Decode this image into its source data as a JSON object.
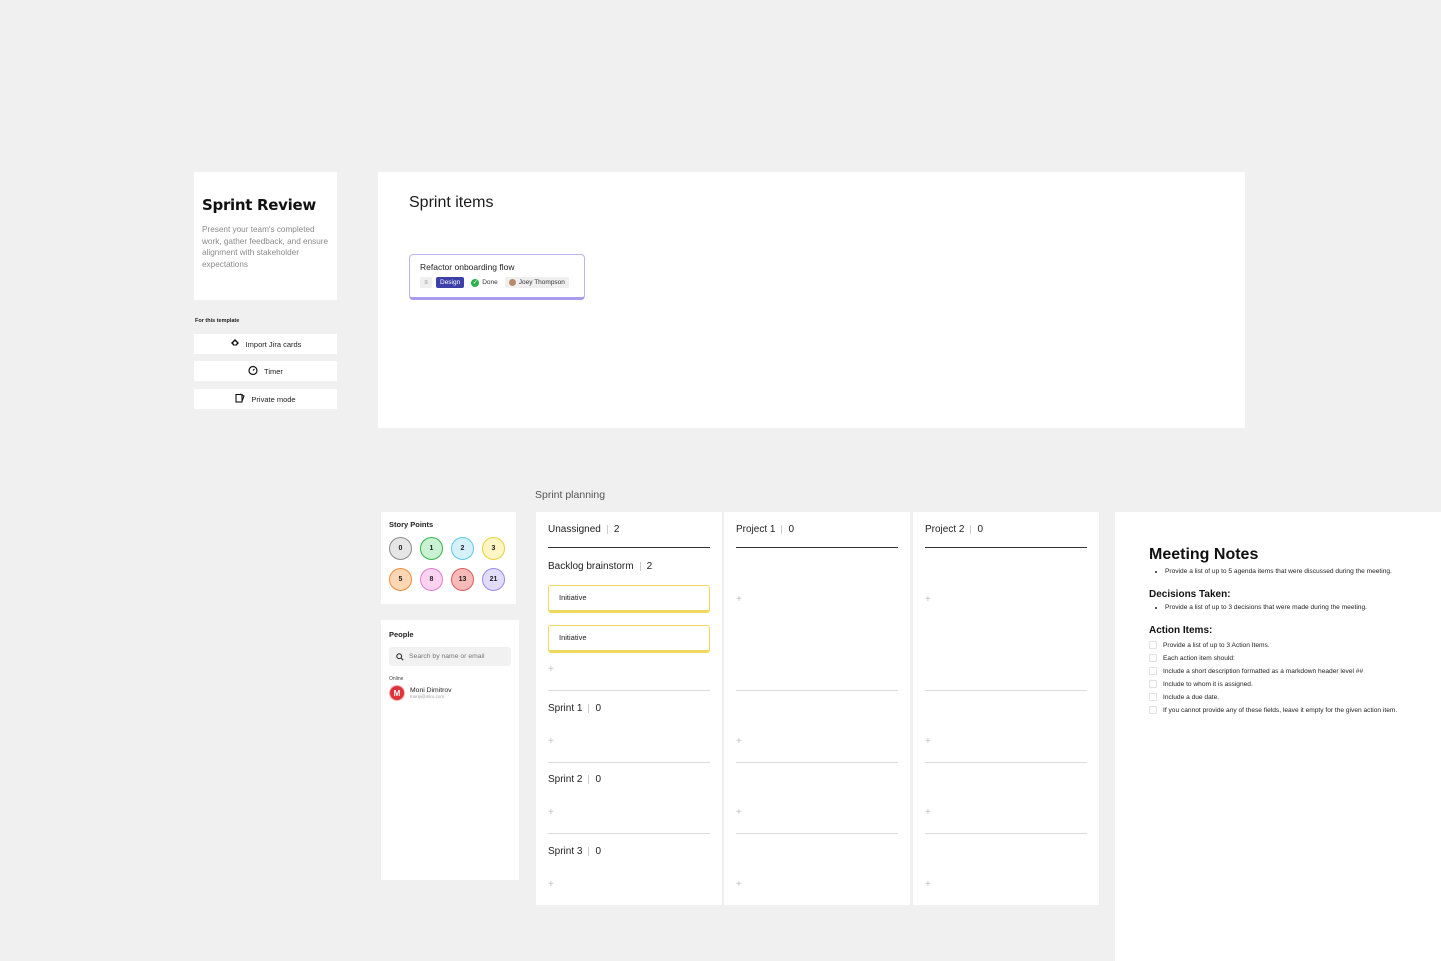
{
  "template": {
    "title": "Sprint Review",
    "description": "Present your team's completed work, gather feedback, and ensure alignment with stakeholder expectations",
    "for_label": "For this template",
    "buttons": [
      {
        "label": "Import Jira cards",
        "icon": "jira-icon"
      },
      {
        "label": "Timer",
        "icon": "timer-icon"
      },
      {
        "label": "Private mode",
        "icon": "private-mode-icon"
      }
    ]
  },
  "sprint_items": {
    "title": "Sprint items",
    "card": {
      "title": "Refactor onboarding flow",
      "tag": "Design",
      "status": "Done",
      "assignee": "Joey Thompson"
    }
  },
  "planning": {
    "label": "Sprint planning",
    "story_points": {
      "title": "Story Points",
      "values": [
        {
          "label": "0",
          "fill": "#e6e6e6",
          "border": "#8a8a8a"
        },
        {
          "label": "1",
          "fill": "#c9f2d2",
          "border": "#37b24d"
        },
        {
          "label": "2",
          "fill": "#d4f1fa",
          "border": "#5fc6e6"
        },
        {
          "label": "3",
          "fill": "#fdf6c4",
          "border": "#e8cf3c"
        },
        {
          "label": "5",
          "fill": "#fcd7b3",
          "border": "#f08c3c"
        },
        {
          "label": "8",
          "fill": "#fbd3f0",
          "border": "#e07cd0"
        },
        {
          "label": "13",
          "fill": "#f8b9b9",
          "border": "#e05a5a"
        },
        {
          "label": "21",
          "fill": "#e2dcfb",
          "border": "#9b88e8"
        }
      ]
    },
    "people": {
      "title": "People",
      "search_placeholder": "Search by name or email",
      "online_label": "Online",
      "person": {
        "initial": "M",
        "name": "Moni Dimitrov",
        "email": "mony@miro.com"
      }
    },
    "columns": [
      {
        "name": "Unassigned",
        "count": "2"
      },
      {
        "name": "Project 1",
        "count": "0"
      },
      {
        "name": "Project 2",
        "count": "0"
      }
    ],
    "groups": [
      {
        "name": "Backlog brainstorm",
        "count": "2"
      },
      {
        "name": "Sprint 1",
        "count": "0"
      },
      {
        "name": "Sprint 2",
        "count": "0"
      },
      {
        "name": "Sprint 3",
        "count": "0"
      }
    ],
    "initiatives": [
      "Initiative",
      "Initiative"
    ],
    "plus": "+"
  },
  "notes": {
    "title": "Meeting Notes",
    "agenda": "Provide a list of up to 5 agenda items that were discussed during the meeting.",
    "decisions_title": "Decisions Taken:",
    "decisions": "Provide a list of up to 3 decisions that were made during the meeting.",
    "actions_title": "Action Items:",
    "actions": [
      "Provide a list of up to 3 Action Items.",
      "Each action item should:",
      "Include a short description formatted as a markdown header level ##",
      "Include to whom it is assigned.",
      "Include a due date.",
      "If you cannot provide any of these fields, leave it empty for the given action item."
    ]
  }
}
